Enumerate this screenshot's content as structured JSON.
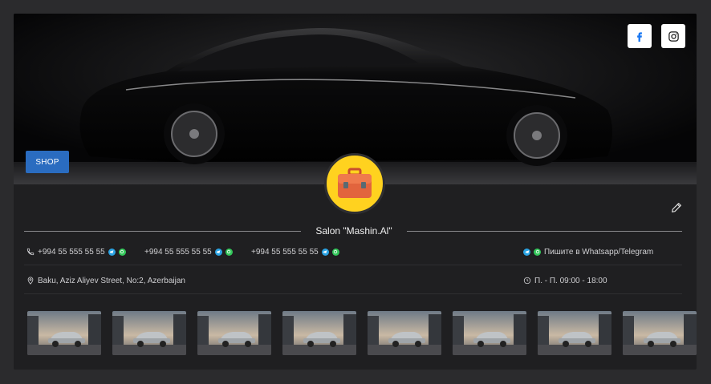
{
  "shop_label": "SHOP",
  "salon_name": "Salon \"Mashin.Al\"",
  "phones": [
    "+994 55 555 55 55",
    "+994 55 555 55 55",
    "+994 55 555 55 55"
  ],
  "contact_hint": "Пишите в Whatsapp/Telegram",
  "address": "Baku, Aziz Aliyev Street, No:2, Azerbaijan",
  "hours": "П. - П. 09:00 - 18:00",
  "colors": {
    "accent": "#2a6cc0",
    "avatar_bg": "#ffd21f",
    "telegram": "#2aa3e3",
    "whatsapp": "#33c75a"
  },
  "icons": {
    "social": [
      "facebook-icon",
      "instagram-icon"
    ],
    "avatar": "briefcase-icon",
    "edit": "pencil-icon",
    "phone": "phone-icon",
    "location": "location-pin-icon",
    "clock": "clock-icon"
  },
  "gallery_count": 8
}
